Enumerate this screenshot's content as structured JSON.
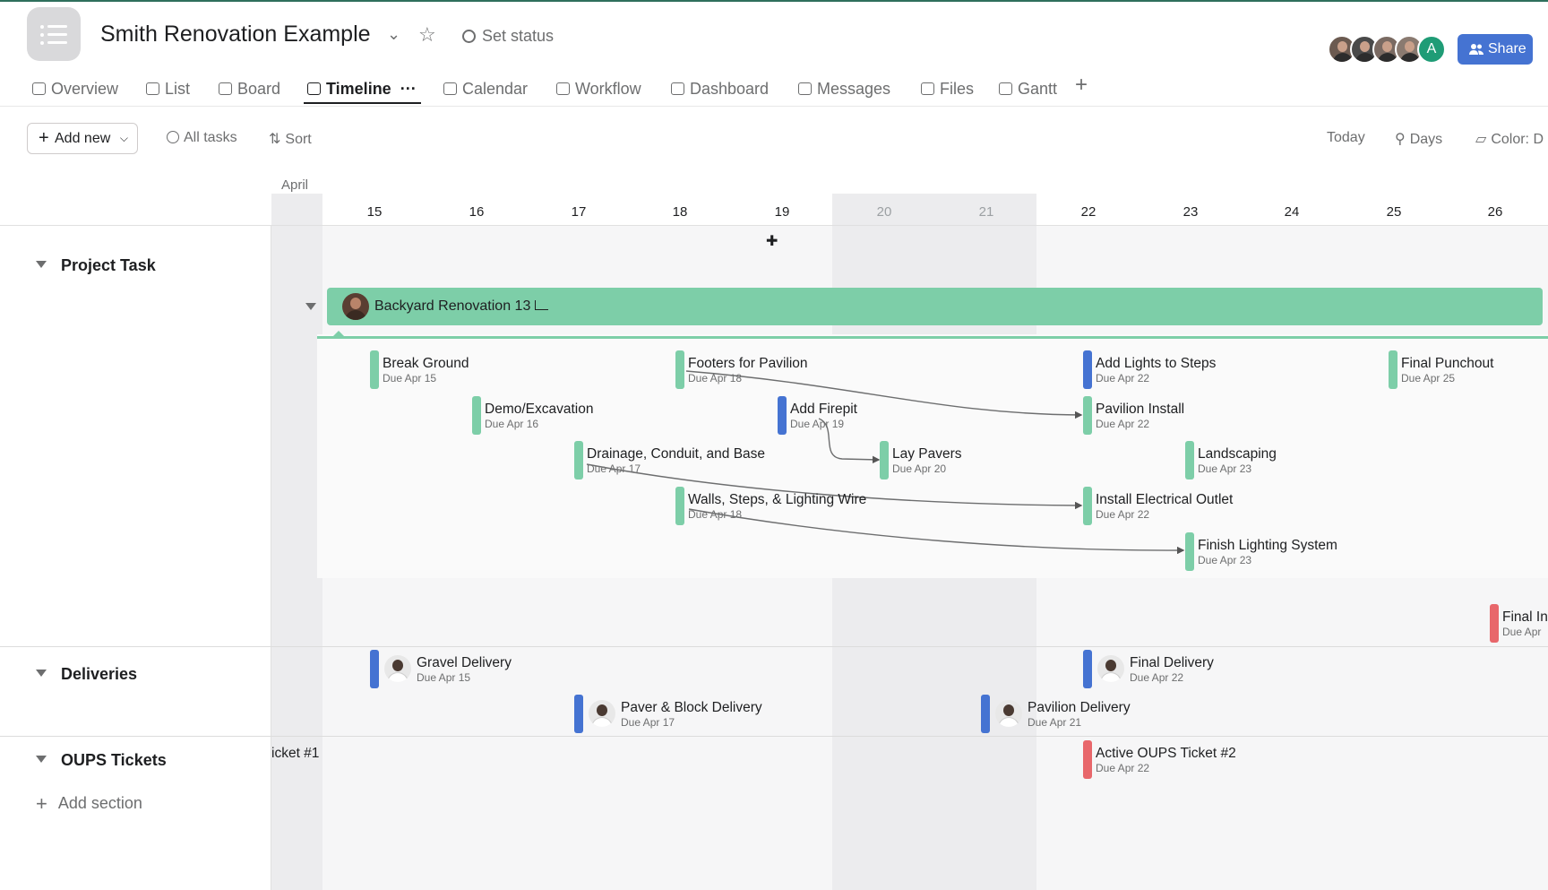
{
  "header": {
    "project_title": "Smith Renovation Example",
    "set_status": "Set status",
    "share_label": "Share",
    "avatar_letter": "A"
  },
  "tabs": [
    {
      "label": "Overview",
      "icon": "overview-icon"
    },
    {
      "label": "List",
      "icon": "list-icon"
    },
    {
      "label": "Board",
      "icon": "board-icon"
    },
    {
      "label": "Timeline",
      "icon": "timeline-icon",
      "active": true
    },
    {
      "label": "Calendar",
      "icon": "calendar-icon"
    },
    {
      "label": "Workflow",
      "icon": "workflow-icon"
    },
    {
      "label": "Dashboard",
      "icon": "dashboard-icon"
    },
    {
      "label": "Messages",
      "icon": "messages-icon"
    },
    {
      "label": "Files",
      "icon": "files-icon"
    },
    {
      "label": "Gantt",
      "icon": "gantt-icon"
    }
  ],
  "tab_more": "···",
  "tab_add": "+",
  "toolbar": {
    "add_new": "Add new",
    "all_tasks": "All tasks",
    "sort": "Sort",
    "today": "Today",
    "days": "Days",
    "color": "Color: D"
  },
  "timeline": {
    "month": "April",
    "days": [
      "15",
      "16",
      "17",
      "18",
      "19",
      "20",
      "21",
      "22",
      "23",
      "24",
      "25",
      "26"
    ]
  },
  "sections": [
    {
      "label": "Project Task"
    },
    {
      "label": "Deliveries"
    },
    {
      "label": "OUPS Tickets"
    }
  ],
  "add_section": "Add section",
  "parent_task": {
    "name": "Backyard Renovation",
    "subtask_count": "13"
  },
  "tasks": [
    {
      "name": "Break Ground",
      "due": "Due Apr 15",
      "color": "#7dcea8"
    },
    {
      "name": "Footers for Pavilion",
      "due": "Due Apr 18",
      "color": "#7dcea8"
    },
    {
      "name": "Add Lights to Steps",
      "due": "Due Apr 22",
      "color": "#4573d2"
    },
    {
      "name": "Final Punchout",
      "due": "Due Apr 25",
      "color": "#7dcea8"
    },
    {
      "name": "Demo/Excavation",
      "due": "Due Apr 16",
      "color": "#7dcea8"
    },
    {
      "name": "Add Firepit",
      "due": "Due Apr 19",
      "color": "#4573d2"
    },
    {
      "name": "Pavilion Install",
      "due": "Due Apr 22",
      "color": "#7dcea8"
    },
    {
      "name": "Drainage, Conduit, and Base",
      "due": "Due Apr 17",
      "color": "#7dcea8"
    },
    {
      "name": "Lay Pavers",
      "due": "Due Apr 20",
      "color": "#7dcea8"
    },
    {
      "name": "Landscaping",
      "due": "Due Apr 23",
      "color": "#7dcea8"
    },
    {
      "name": "Walls, Steps, & Lighting Wire",
      "due": "Due Apr 18",
      "color": "#7dcea8"
    },
    {
      "name": "Install Electrical Outlet",
      "due": "Due Apr 22",
      "color": "#7dcea8"
    },
    {
      "name": "Finish Lighting System",
      "due": "Due Apr 23",
      "color": "#7dcea8"
    },
    {
      "name": "Final In",
      "due": "Due Apr",
      "color": "#e8676b"
    }
  ],
  "deliveries": [
    {
      "name": "Gravel Delivery",
      "due": "Due Apr 15",
      "color": "#4573d2"
    },
    {
      "name": "Final Delivery",
      "due": "Due Apr 22",
      "color": "#4573d2"
    },
    {
      "name": "Paver & Block Delivery",
      "due": "Due Apr 17",
      "color": "#4573d2"
    },
    {
      "name": "Pavilion Delivery",
      "due": "Due Apr 21",
      "color": "#4573d2"
    }
  ],
  "oups": [
    {
      "name": "icket #1"
    },
    {
      "name": "Active OUPS Ticket #2",
      "due": "Due Apr 22",
      "color": "#e8676b"
    }
  ]
}
